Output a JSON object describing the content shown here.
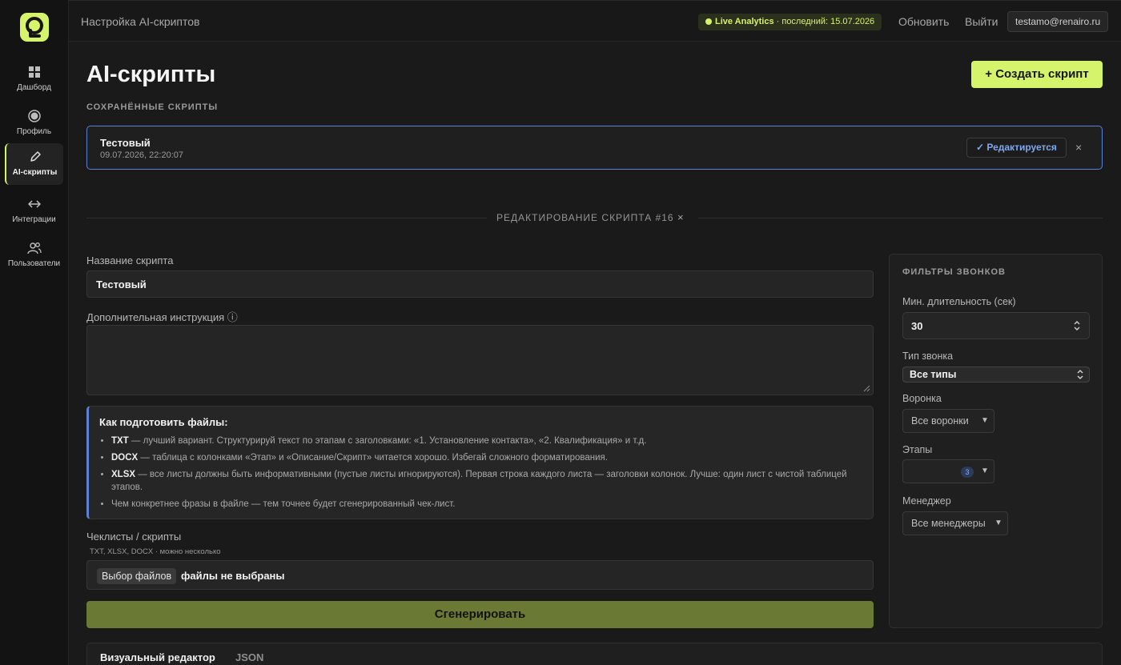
{
  "nav": {
    "items": [
      {
        "label": "Дашборд",
        "icon": "dashboard-icon"
      },
      {
        "label": "Профиль",
        "icon": "profile-icon"
      },
      {
        "label": "AI-скрипты",
        "icon": "pencil-icon",
        "active": true
      },
      {
        "label": "Интеграции",
        "icon": "arrows-icon"
      },
      {
        "label": "Пользователи",
        "icon": "users-icon"
      }
    ]
  },
  "topbar": {
    "title": "Настройка AI-скриптов",
    "live_name": "Live Analytics",
    "live_status": "· последний: 15.07.2026",
    "refresh": "Обновить",
    "logout": "Выйти",
    "user": "testamo@renairo.ru"
  },
  "page": {
    "title": "AI-скрипты",
    "create_button": "+ Создать скрипт",
    "saved_caption": "СОХРАНЁННЫЕ СКРИПТЫ"
  },
  "saved_script": {
    "name": "Тестовый",
    "date": "09.07.2026, 22:20:07",
    "badge": "✓ Редактируется",
    "close": "×"
  },
  "editor": {
    "heading": "РЕДАКТИРОВАНИЕ СКРИПТА #16",
    "close": "×",
    "name_label": "Название скрипта",
    "name_value": "Тестовый",
    "instruction_label": "Дополнительная инструкция ⓘ",
    "instruction_value": "",
    "info": {
      "title": "Как подготовить файлы:",
      "items": [
        {
          "bold": "TXT",
          "text": " — лучший вариант. Структурируй текст по этапам с заголовками: «1. Установление контакта», «2. Квалификация» и т.д."
        },
        {
          "bold": "DOCX",
          "text": " — таблица с колонками «Этап» и «Описание/Скрипт» читается хорошо. Избегай сложного форматирования."
        },
        {
          "bold": "XLSX",
          "text": " — все листы должны быть информативными (пустые листы игнорируются). Первая строка каждого листа — заголовки колонок. Лучше: один лист с чистой таблицей этапов."
        },
        {
          "bold": "",
          "text": "Чем конкретнее фразы в файле — тем точнее будет сгенерированный чек-лист."
        }
      ]
    },
    "files_label": "Чеклисты / скрипты",
    "files_hint": "TXT, XLSX, DOCX · можно несколько",
    "file_button": "Выбор файлов",
    "file_status": "файлы не выбраны",
    "generate": "Сгенерировать",
    "tabs": [
      "Визуальный редактор",
      "JSON"
    ]
  },
  "filters": {
    "caption": "ФИЛЬТРЫ ЗВОНКОВ",
    "min_duration_label": "Мин. длительность (сек)",
    "min_duration_value": "30",
    "call_type_label": "Тип звонка",
    "call_type_value": "Все типы",
    "funnel_label": "Воронка",
    "funnel_value": "Все воронки",
    "stages_label": "Этапы",
    "stages_count": "3",
    "manager_label": "Менеджер",
    "manager_value": "Все менеджеры"
  },
  "colors": {
    "accent": "#d6f36c",
    "focus_blue": "#5d7fd6",
    "generate_button": "#6a7a35"
  }
}
